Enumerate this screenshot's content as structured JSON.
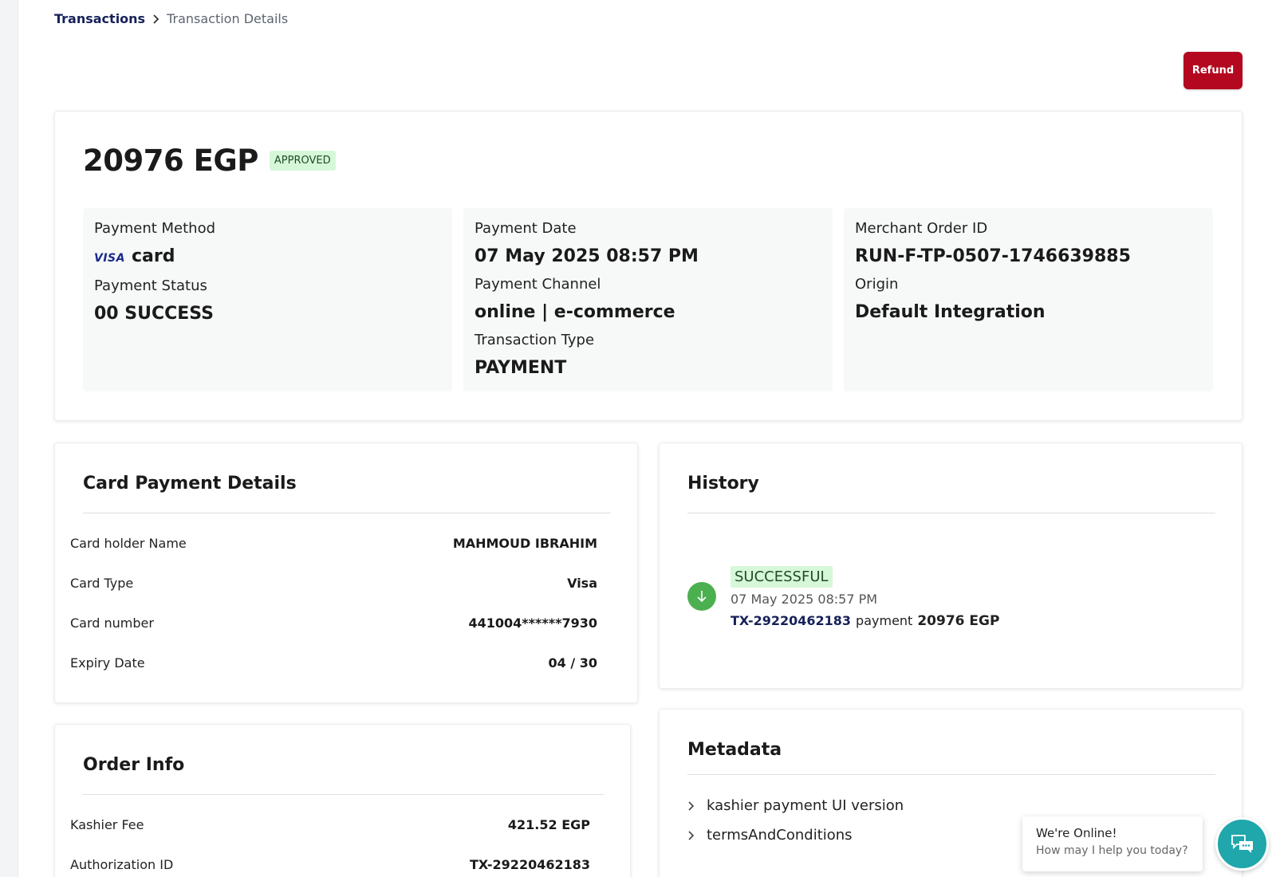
{
  "breadcrumb": {
    "parent": "Transactions",
    "current": "Transaction Details"
  },
  "actions": {
    "refund_label": "Refund"
  },
  "colors": {
    "refund": "#b3081f",
    "approved_bg": "#d7f7d9",
    "success_icon": "#4caf50",
    "link": "#16215a",
    "chat": "#1fa7ab"
  },
  "summary": {
    "amount": "20976 EGP",
    "status": "APPROVED",
    "payment_method_label": "Payment Method",
    "payment_method_brand": "VISA",
    "payment_method_value": "card",
    "payment_status_label": "Payment Status",
    "payment_status_value": "00 SUCCESS",
    "payment_date_label": "Payment Date",
    "payment_date_value": "07 May 2025 08:57 PM",
    "payment_channel_label": "Payment Channel",
    "payment_channel_value": "online | e-commerce",
    "transaction_type_label": "Transaction Type",
    "transaction_type_value": "PAYMENT",
    "merchant_order_label": "Merchant Order ID",
    "merchant_order_value": "RUN-F-TP-0507-1746639885",
    "origin_label": "Origin",
    "origin_value": "Default Integration"
  },
  "card_details": {
    "title": "Card Payment Details",
    "rows": [
      {
        "label": "Card holder Name",
        "value": "MAHMOUD IBRAHIM"
      },
      {
        "label": "Card Type",
        "value": "Visa"
      },
      {
        "label": "Card number",
        "value": "441004******7930"
      },
      {
        "label": "Expiry Date",
        "value": "04 / 30"
      }
    ]
  },
  "history": {
    "title": "History",
    "status": "SUCCESSFUL",
    "date": "07 May 2025 08:57 PM",
    "tx_id": "TX-29220462183",
    "type": "payment",
    "amount": "20976 EGP",
    "icon": "arrow-down-icon"
  },
  "order_info": {
    "title": "Order Info",
    "rows": [
      {
        "label": "Kashier Fee",
        "value": "421.52 EGP"
      },
      {
        "label": "Authorization ID",
        "value": "TX-29220462183"
      }
    ]
  },
  "metadata": {
    "title": "Metadata",
    "items": [
      "kashier payment UI version",
      "termsAndConditions"
    ]
  },
  "chat": {
    "title": "We're Online!",
    "subtitle": "How may I help you today?",
    "icon": "chat-icon"
  }
}
